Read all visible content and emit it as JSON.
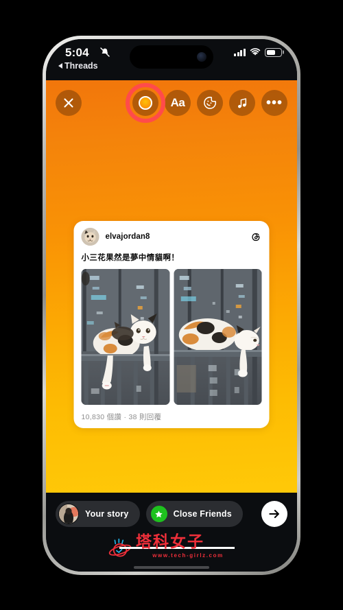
{
  "status_bar": {
    "time": "5:04",
    "back_label": "Threads",
    "mute_icon": "bell-slash-icon",
    "signal_icon": "cellular-signal-icon",
    "wifi_icon": "wifi-icon",
    "battery_icon": "battery-icon",
    "battery_level": "62%"
  },
  "toolbar": {
    "close_label": "✕",
    "close_icon": "close-icon",
    "background_color_icon": "background-color-circle-icon",
    "text_label": "Aa",
    "text_icon": "text-tool-icon",
    "sticker_icon": "sticker-icon",
    "music_icon": "music-note-icon",
    "more_label": "•••",
    "more_icon": "more-options-icon",
    "highlight_color": "#FF4B4B"
  },
  "post_card": {
    "username": "elvajordan8",
    "avatar_icon": "cat-avatar",
    "platform_icon": "threads-logo-icon",
    "text": "小三花果然是夢中情貓啊！",
    "stats": "10,830 個讚 · 38 則回覆",
    "photos": [
      {
        "alt_name": "calico-cat-sitting-on-railing"
      },
      {
        "alt_name": "calico-cat-lying-on-railing"
      }
    ]
  },
  "share_bar": {
    "your_story_label": "Your story",
    "your_story_avatar_icon": "user-avatar",
    "close_friends_label": "Close Friends",
    "close_friends_badge_icon": "green-star-icon",
    "close_friends_badge_color": "#1EC11E",
    "send_icon": "arrow-right-icon"
  },
  "watermark": {
    "brand": "塔科女子",
    "url": "www.tech-girlz.com",
    "planet_icon": "planet-icon",
    "color": "#EF2F3A"
  },
  "theme": {
    "story_gradient_top": "#F2760B",
    "story_gradient_bottom": "#FFC908",
    "chrome_dark": "#0B0D10"
  }
}
